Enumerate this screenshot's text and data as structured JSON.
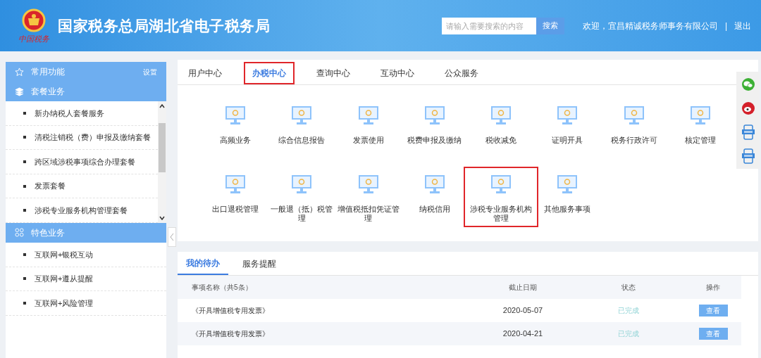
{
  "header": {
    "title": "国家税务总局湖北省电子税务局",
    "logo_caption": "中国税务",
    "search": {
      "placeholder": "请输入需要搜索的内容",
      "button": "搜索"
    },
    "welcome": "欢迎，宜昌精诚税务师事务有限公司",
    "separator": "|",
    "logout": "退出"
  },
  "sidebar": {
    "sections": [
      {
        "kind": "star",
        "title": "常用功能",
        "action": "设置"
      },
      {
        "kind": "layers",
        "title": "套餐业务",
        "scrollable": true,
        "items": [
          "新办纳税人套餐服务",
          "清税注销税（费）申报及缴纳套餐",
          "跨区域涉税事项综合办理套餐",
          "发票套餐",
          "涉税专业服务机构管理套餐"
        ]
      },
      {
        "kind": "grid",
        "title": "特色业务",
        "items": [
          "互联网+银税互动",
          "互联网+遵从提醒",
          "互联网+风险管理"
        ]
      }
    ]
  },
  "main_tabs": [
    {
      "label": "用户中心",
      "selected": false,
      "highlighted": false
    },
    {
      "label": "办税中心",
      "selected": true,
      "highlighted": true
    },
    {
      "label": "查询中心",
      "selected": false,
      "highlighted": false
    },
    {
      "label": "互动中心",
      "selected": false,
      "highlighted": false
    },
    {
      "label": "公众服务",
      "selected": false,
      "highlighted": false
    }
  ],
  "tiles": [
    {
      "label": "高频业务",
      "highlighted": false
    },
    {
      "label": "综合信息报告",
      "highlighted": false
    },
    {
      "label": "发票使用",
      "highlighted": false
    },
    {
      "label": "税费申报及缴纳",
      "highlighted": false
    },
    {
      "label": "税收减免",
      "highlighted": false
    },
    {
      "label": "证明开具",
      "highlighted": false
    },
    {
      "label": "税务行政许可",
      "highlighted": false
    },
    {
      "label": "核定管理",
      "highlighted": false
    },
    {
      "label": "出口退税管理",
      "highlighted": false
    },
    {
      "label": "一般退（抵）税管理",
      "highlighted": false
    },
    {
      "label": "增值税抵扣凭证管理",
      "highlighted": false
    },
    {
      "label": "纳税信用",
      "highlighted": false
    },
    {
      "label": "涉税专业服务机构管理",
      "highlighted": true
    },
    {
      "label": "其他服务事项",
      "highlighted": false
    }
  ],
  "side_icons": [
    {
      "kind": "wechat"
    },
    {
      "kind": "weibo"
    },
    {
      "kind": "app"
    },
    {
      "kind": "app"
    }
  ],
  "todo": {
    "tabs": [
      {
        "label": "我的待办",
        "selected": true
      },
      {
        "label": "服务提醒",
        "selected": false
      }
    ],
    "columns": [
      "事项名称（共5条）",
      "截止日期",
      "状态",
      "操作"
    ],
    "rows": [
      {
        "name": "《开具增值税专用发票》",
        "date": "2020-05-07",
        "status": "已完成",
        "action": "查看"
      },
      {
        "name": "《开具增值税专用发票》",
        "date": "2020-04-21",
        "status": "已完成",
        "action": "查看"
      }
    ]
  }
}
